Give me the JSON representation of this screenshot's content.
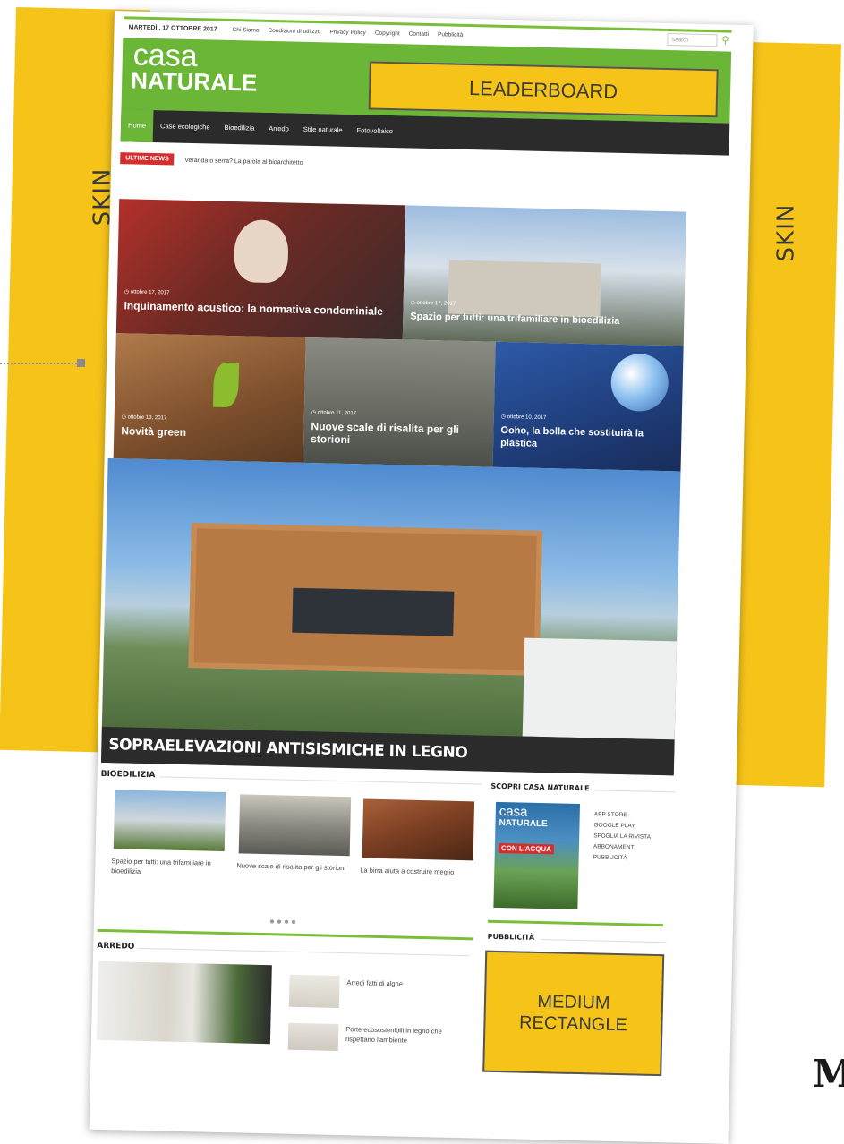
{
  "skin_label": "SKIN",
  "topbar": {
    "date": "MARTEDÌ , 17 OTTOBRE 2017",
    "links": [
      "Chi Siamo",
      "Condizioni di utilizzo",
      "Privacy Policy",
      "Copyright",
      "Contatti",
      "Pubblicità"
    ],
    "search_placeholder": "Search"
  },
  "logo": {
    "line1": "casa",
    "line2": "NATURALE"
  },
  "leaderboard": "LEADERBOARD",
  "nav": [
    "Home",
    "Case ecologiche",
    "Bioedilizia",
    "Arredo",
    "Stile naturale",
    "Fotovoltaico"
  ],
  "ticker": {
    "tag": "ULTIME NEWS",
    "text": "Veranda o serra? La parola al bioarchitetto"
  },
  "tiles": [
    {
      "date": "◷ ottobre 17, 2017",
      "title": "Inquinamento acustico: la normativa condominiale"
    },
    {
      "date": "◷ ottobre 17, 2017",
      "title": "Spazio per tutti: una trifamiliare in bioedilizia"
    },
    {
      "date": "◷ ottobre 13, 2017",
      "title": "Novità green"
    },
    {
      "date": "◷ ottobre 11, 2017",
      "title": "Nuove scale di risalita per gli storioni"
    },
    {
      "date": "◷ ottobre 10, 2017",
      "title": "Ooho, la bolla che sostituirà la plastica"
    }
  ],
  "hero_title": "SOPRAELEVAZIONI ANTISISMICHE IN LEGNO",
  "bioedilizia": {
    "title": "BIOEDILIZIA",
    "cards": [
      "Spazio per tutti: una trifamiliare in bioedilizia",
      "Nuove scale di risalita per gli storioni",
      "La birra aiuta a costruire meglio"
    ],
    "dots": "●●●●"
  },
  "scopri": {
    "title": "SCOPRI CASA NATURALE",
    "cover_logo1": "casa",
    "cover_logo2": "NATURALE",
    "cover_text": "CON L'ACQUA",
    "links": [
      "APP STORE",
      "GOOGLE PLAY",
      "SFOGLIA LA RIVISTA",
      "ABBONAMENTI",
      "PUBBLICITÀ"
    ]
  },
  "arredo": {
    "title": "ARREDO",
    "items": [
      "Arredi fatti di alghe",
      "Porte ecosostenibili in legno che rispettano l'ambiente"
    ]
  },
  "pubblicita": "PUBBLICITÀ",
  "medium_rectangle": {
    "line1": "MEDIUM",
    "line2": "RECTANGLE"
  },
  "corner_logo": "M",
  "colors": {
    "skin": "#f6c419",
    "green": "#6bb537",
    "dark": "#2b2b2b",
    "red": "#d62e2e"
  }
}
